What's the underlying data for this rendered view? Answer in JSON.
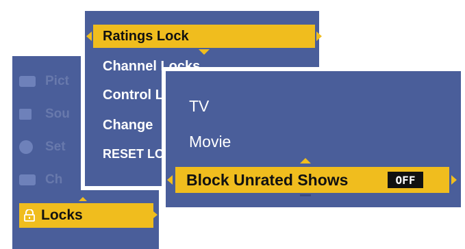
{
  "main_menu": {
    "faded_items": [
      {
        "label": "Pict",
        "icon": "picture-icon"
      },
      {
        "label": "Sou",
        "icon": "sound-icon"
      },
      {
        "label": "Set",
        "icon": "setup-icon"
      },
      {
        "label": "Ch",
        "icon": "channel-icon"
      }
    ],
    "selected": {
      "label": "Locks",
      "icon": "lock-icon"
    }
  },
  "locks_menu": {
    "selected_label": "Ratings Lock",
    "items": [
      "Channel Locks",
      "Control L",
      "Change",
      "RESET LO"
    ]
  },
  "ratings_menu": {
    "items": [
      "TV",
      "Movie"
    ],
    "selected_label": "Block Unrated Shows",
    "selected_value": "OFF"
  },
  "colors": {
    "panel_bg": "#4a5e9a",
    "highlight": "#f0bd1e",
    "border": "#ffffff"
  }
}
